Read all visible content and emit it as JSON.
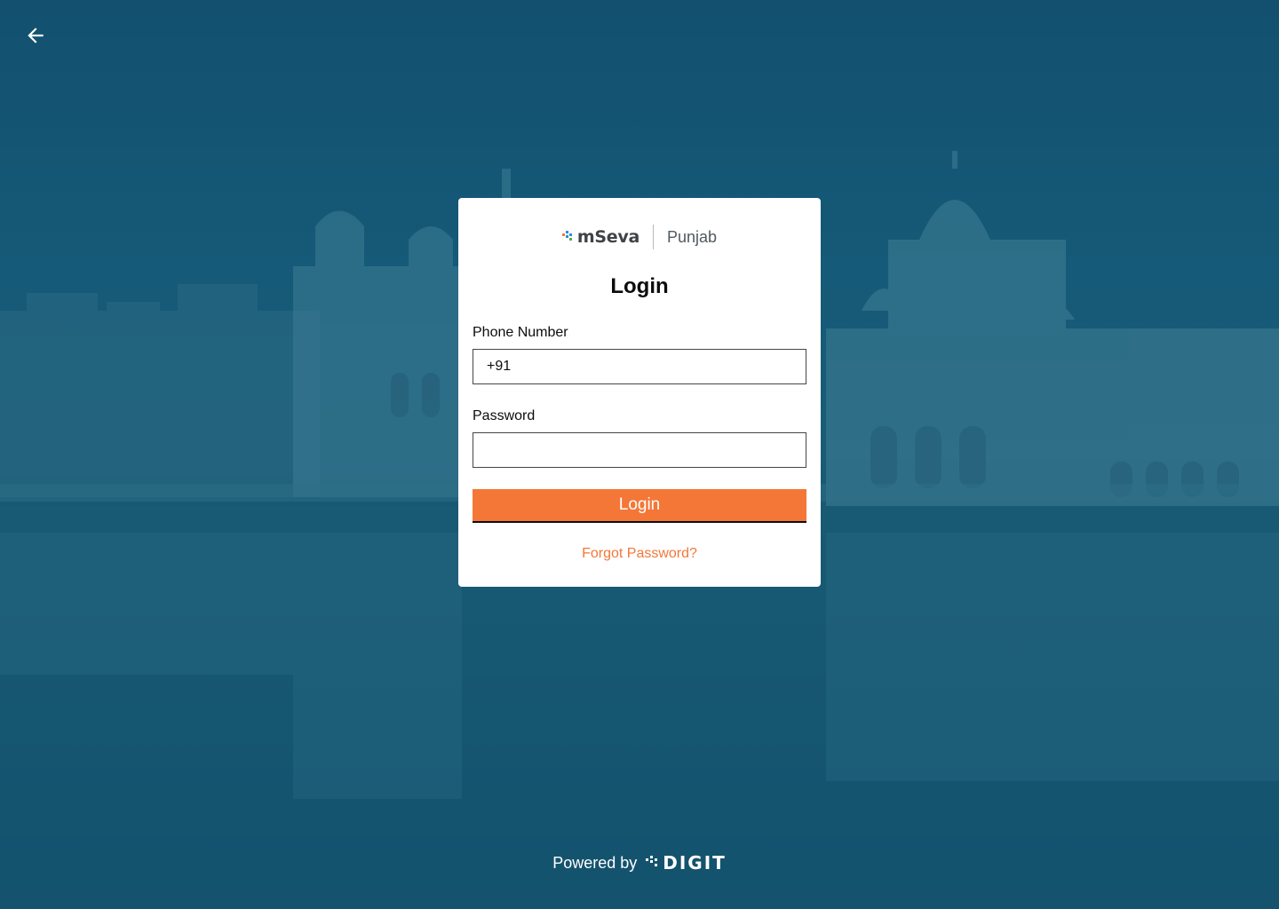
{
  "navigation": {
    "back_icon": "arrow-left-icon"
  },
  "brand": {
    "logo_text": "mSeva",
    "city": "Punjab",
    "logo_colors": [
      "#f47738",
      "#2a8fd8",
      "#4caf50"
    ]
  },
  "login_form": {
    "title": "Login",
    "phone_label": "Phone Number",
    "phone_prefix": "+91",
    "phone_value": "",
    "password_label": "Password",
    "password_value": "",
    "submit_label": "Login",
    "forgot_password_label": "Forgot Password?"
  },
  "footer": {
    "powered_by": "Powered by",
    "digit_logo_text": "DIGIT"
  },
  "colors": {
    "accent": "#f47738",
    "background": "#155a78"
  }
}
